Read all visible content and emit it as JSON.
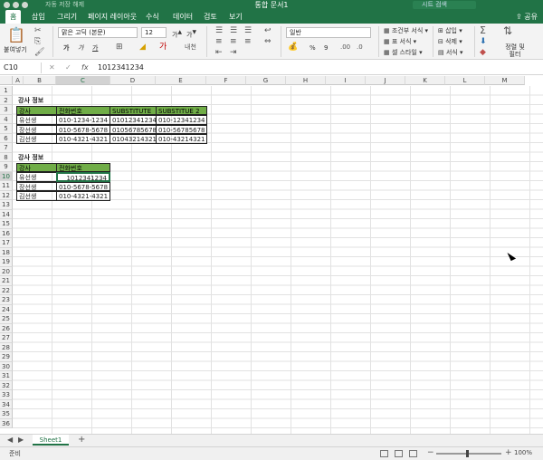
{
  "titlebar": {
    "title": "통합 문서1",
    "autosave": "자동 저장",
    "autosave_state": "해제",
    "search_placeholder": "시트 검색"
  },
  "tabs": [
    "홈",
    "삽입",
    "그리기",
    "페이지 레이아웃",
    "수식",
    "데이터",
    "검토",
    "보기"
  ],
  "share_label": "공유",
  "ribbon": {
    "paste": "붙여넣기",
    "font_name": "맑은 고딕 (본문)",
    "font_size": "12",
    "bold": "가",
    "italic": "가",
    "underline": "가",
    "number_format": "일반",
    "conditional_format": "조건부 서식",
    "table_format": "표 서식",
    "cell_style": "셀 스타일",
    "insert": "삽입",
    "delete": "삭제",
    "format": "서식",
    "sort_filter": "정렬 및 필터",
    "percent": "%",
    "comma": "9"
  },
  "formula": {
    "name_box": "C10",
    "content": "1012341234",
    "fx": "fx"
  },
  "columns": [
    "A",
    "B",
    "C",
    "D",
    "E",
    "F",
    "G",
    "H",
    "I",
    "J",
    "K",
    "L",
    "M"
  ],
  "rows": [
    "1",
    "2",
    "3",
    "4",
    "5",
    "6",
    "7",
    "8",
    "9",
    "10",
    "11",
    "12",
    "13",
    "14",
    "15",
    "16",
    "17",
    "18",
    "19",
    "20",
    "21",
    "22",
    "23",
    "24",
    "25",
    "26",
    "27",
    "28",
    "29",
    "30",
    "31",
    "32",
    "33",
    "34",
    "35",
    "36"
  ],
  "table1": {
    "title": "강사 정보",
    "headers": [
      "강사",
      "전화번호",
      "SUBSTITUTE",
      "SUBSTITUE 2"
    ],
    "rows": [
      [
        "유선생",
        "010-1234-1234",
        "01012341234",
        "010-12341234"
      ],
      [
        "장선생",
        "010-5678-5678",
        "01056785678",
        "010-56785678"
      ],
      [
        "김선생",
        "010-4321-4321",
        "01043214321",
        "010-43214321"
      ]
    ]
  },
  "table2": {
    "title": "강사 정보",
    "headers": [
      "강사",
      "전화번호"
    ],
    "rows": [
      [
        "유선생",
        "1012341234"
      ],
      [
        "장선생",
        "010-5678-5678"
      ],
      [
        "김선생",
        "010-4321-4321"
      ]
    ]
  },
  "sheet_tab": "Sheet1",
  "status": "준비",
  "zoom": "100%",
  "colors": {
    "accent": "#217346",
    "header_fill": "#70ad47"
  }
}
